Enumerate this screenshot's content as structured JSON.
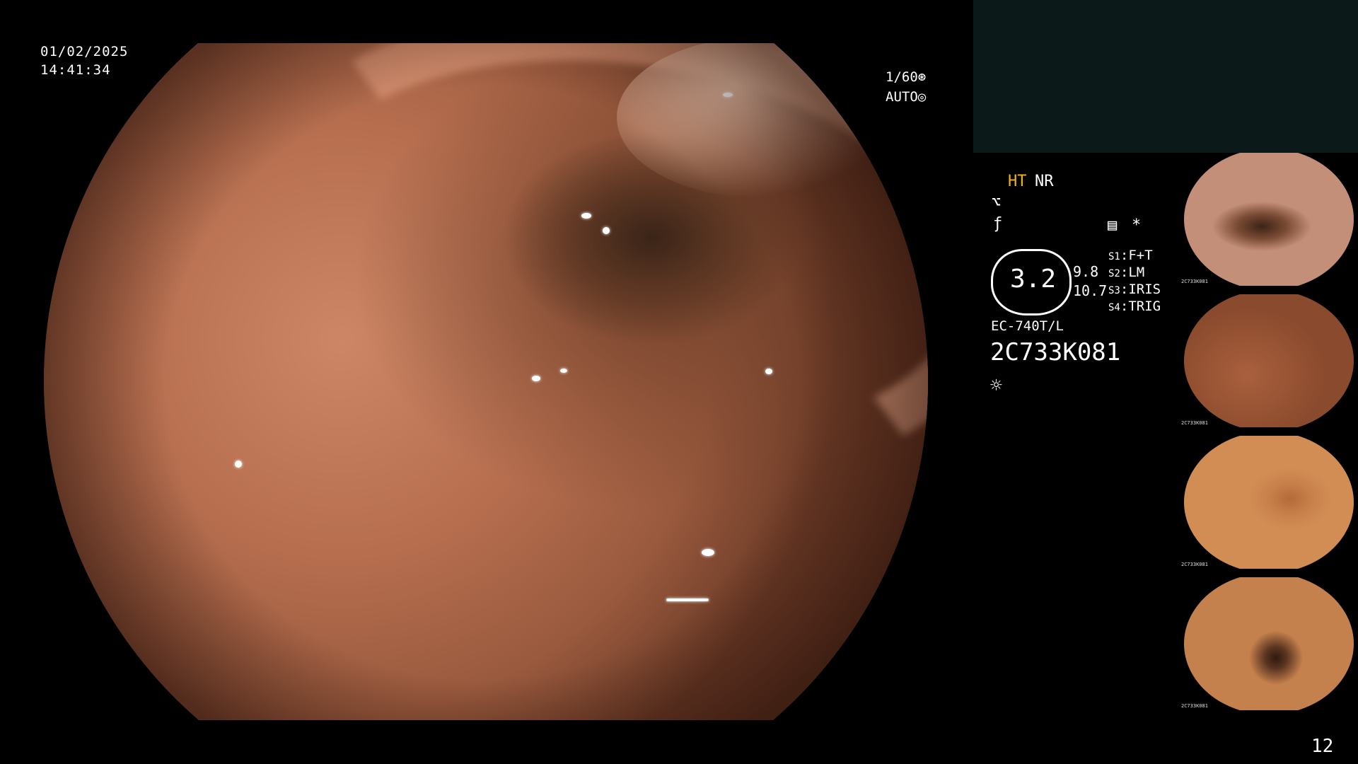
{
  "overlay": {
    "date": "01/02/2025",
    "time": "14:41:34",
    "shutter": "1/60",
    "exposure_mode": "AUTO"
  },
  "side_info": {
    "ht": "HT",
    "nr": "NR",
    "gauge_value": "3.2",
    "gauge_values": [
      "9.8",
      "10.7"
    ],
    "switches": [
      {
        "key": "S1",
        "value": "F+T"
      },
      {
        "key": "S2",
        "value": "LM"
      },
      {
        "key": "S3",
        "value": "IRIS"
      },
      {
        "key": "S4",
        "value": "TRIG"
      }
    ],
    "scope_model": "EC-740T/L",
    "scope_serial": "2C733K081",
    "icons": [
      "enhancement-icon",
      "color-icon",
      "memory-icon",
      "asterisk-icon",
      "light-icon"
    ]
  },
  "thumbnails": [
    {
      "label": "2C733K081"
    },
    {
      "label": "2C733K081"
    },
    {
      "label": "2C733K081"
    },
    {
      "label": "2C733K081"
    }
  ],
  "page_number": "12",
  "colors": {
    "ht": "#f2b11e",
    "panel": "#0b1a18"
  }
}
